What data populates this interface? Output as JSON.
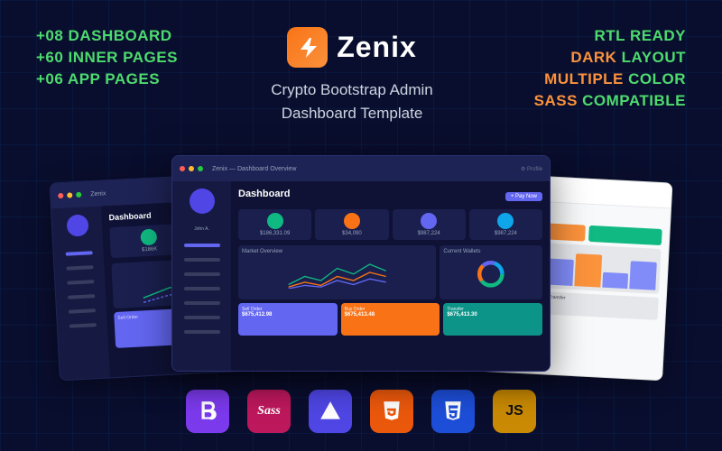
{
  "background": {
    "color": "#0a0e2e"
  },
  "left_features": {
    "items": [
      {
        "label": "+08 DASHBOARD"
      },
      {
        "label": "+60 INNER PAGES"
      },
      {
        "label": "+06 APP PAGES"
      }
    ]
  },
  "logo": {
    "name": "Zenix",
    "icon_label": "lightning-bolt"
  },
  "subtitle": {
    "line1": "Crypto Bootstrap Admin",
    "line2": "Dashboard Template"
  },
  "right_features": {
    "items": [
      {
        "label": "RTL READY",
        "color": "green"
      },
      {
        "label": "DARK LAYOUT",
        "highlight": "DARK",
        "rest": "LAYOUT"
      },
      {
        "label": "MULTIPLE COLOR",
        "highlight": "MULTIPLE",
        "rest": "COLOR"
      },
      {
        "label": "SASS COMPATIBLE",
        "highlight": "SASS",
        "rest": "COMPATIBLE"
      }
    ]
  },
  "tech_stack": {
    "items": [
      {
        "name": "Bootstrap",
        "abbr": "B",
        "key": "bootstrap"
      },
      {
        "name": "Sass",
        "abbr": "Sass",
        "key": "sass"
      },
      {
        "name": "Affinity",
        "abbr": "A",
        "key": "affinity"
      },
      {
        "name": "HTML5",
        "abbr": "5",
        "key": "html"
      },
      {
        "name": "CSS3",
        "abbr": "3",
        "key": "css"
      },
      {
        "name": "JavaScript",
        "abbr": "JS",
        "key": "js"
      }
    ]
  },
  "stat_cards": [
    {
      "color": "#10b981",
      "value": "$186,331.09"
    },
    {
      "color": "#f97316",
      "value": "$34,090"
    },
    {
      "color": "#6366f1",
      "value": "$987,224"
    },
    {
      "color": "#0ea5e9",
      "value": "$987,224"
    }
  ]
}
